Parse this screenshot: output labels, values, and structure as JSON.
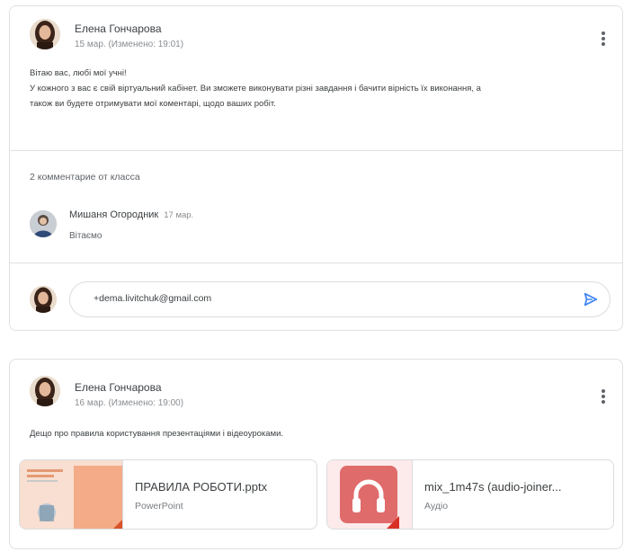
{
  "post1": {
    "author": "Елена Гончарова",
    "date": "15 мар. (Изменено: 19:01)",
    "text_lines": [
      "Вітаю вас, любі мої учні!",
      "У кожного з вас є свій віртуальний кабінет. Ви зможете виконувати різні завдання і бачити вірність їх виконання, а",
      "також ви будете отримувати мої коментарі, щодо ваших робіт."
    ],
    "comments_header": "2 комментарие от класса",
    "comment": {
      "author": "Мишаня Огородник",
      "date": "17 мар.",
      "text": "Вітаємо"
    },
    "comment_input": {
      "value": "+dema.livitchuk@gmail.com"
    }
  },
  "post2": {
    "author": "Елена Гончарова",
    "date": "16 мар. (Изменено: 19:00)",
    "text": "Дещо про правила користування презентаціями і відеоуроками.",
    "attachments": [
      {
        "name": "ПРАВИЛА РОБОТИ.pptx",
        "type": "PowerPoint",
        "icon": "powerpoint-thumbnail",
        "accent": "#f3a27a"
      },
      {
        "name": "mix_1m47s (audio-joiner...",
        "type": "Аудіо",
        "icon": "headphones-icon",
        "accent": "#e06b6b"
      }
    ]
  },
  "colors": {
    "send_icon": "#4285f4",
    "card_border": "#e0e0e0",
    "secondary_text": "#8a8d91"
  }
}
